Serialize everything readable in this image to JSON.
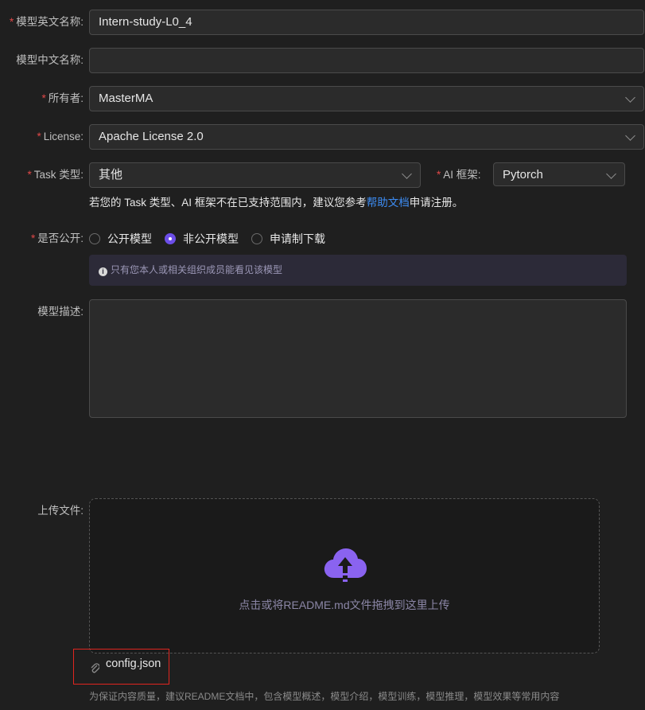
{
  "form": {
    "en_name": {
      "label": "模型英文名称:",
      "value": "Intern-study-L0_4"
    },
    "cn_name": {
      "label": "模型中文名称:",
      "value": ""
    },
    "owner": {
      "label": "所有者:",
      "value": "MasterMA"
    },
    "license": {
      "label": "License:",
      "value": "Apache License 2.0"
    },
    "task": {
      "label": "Task 类型:",
      "value": "其他"
    },
    "framework": {
      "label": "AI 框架:",
      "value": "Pytorch"
    },
    "hint": {
      "before": "若您的 Task 类型、AI 框架不在已支持范围内，建议您参考",
      "link": "帮助文档",
      "after": "申请注册。"
    },
    "visibility": {
      "label": "是否公开:",
      "options": [
        "公开模型",
        "非公开模型",
        "申请制下载"
      ],
      "selected": "非公开模型"
    },
    "notice": "只有您本人或相关组织成员能看见该模型",
    "description": {
      "label": "模型描述:",
      "value": ""
    },
    "upload": {
      "label": "上传文件:",
      "dropzone_text": "点击或将README.md文件拖拽到这里上传",
      "files": [
        "config.json"
      ],
      "footnote": "为保证内容质量，建议README文档中，包含模型概述，模型介绍，模型训练，模型推理，模型效果等常用内容"
    }
  },
  "icons": {
    "dropdown": "chevron-down-icon",
    "upload": "cloud-upload-icon",
    "info": "info-icon",
    "attachment": "paperclip-icon"
  },
  "colors": {
    "accent": "#6c4ee8",
    "required": "#e04848",
    "link": "#3d8df5",
    "highlight_box": "#e0251f"
  }
}
